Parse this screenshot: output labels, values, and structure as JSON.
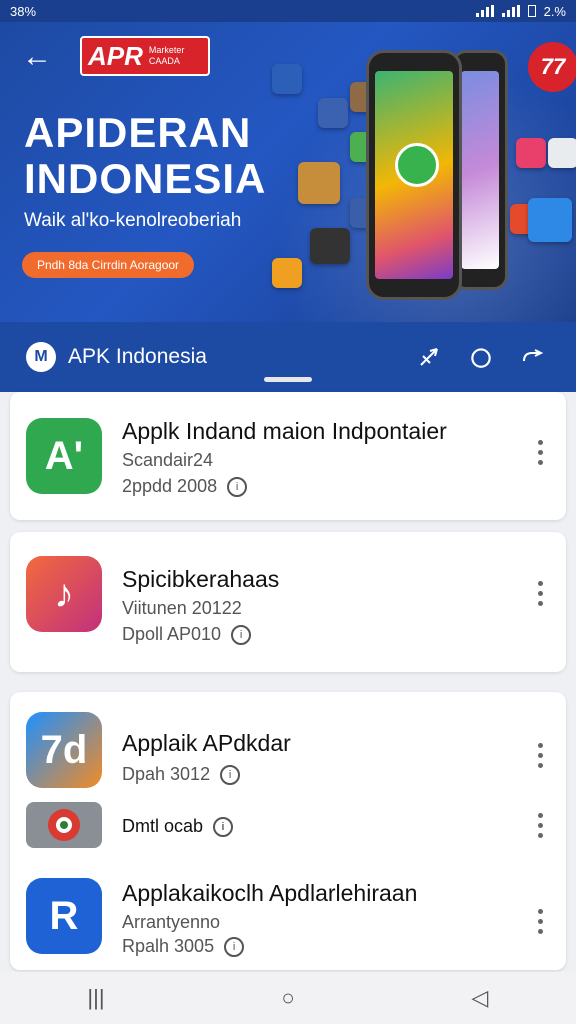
{
  "status_bar": {
    "battery_left": "38%",
    "battery_right": "2.%"
  },
  "hero": {
    "brand_big": "APR",
    "brand_small_1": "Marketer",
    "brand_small_2": "CAADA",
    "headline_1": "APIDERAN",
    "headline_2": "INDONESIA",
    "subtitle": "Waik al'ko-kenolreoberiah",
    "pill": "Pndh 8da Cirrdin Aoragoor",
    "corner_badge": "77"
  },
  "appbar": {
    "logo_letter": "M",
    "title": "APK Indonesia"
  },
  "cards": [
    {
      "rows": [
        {
          "name": "Applk Indand maion Indpontaier",
          "meta1": "Scandair24",
          "meta2": "2ppdd 2008",
          "icon_letter": "A'",
          "icon_color": "#2fa84f"
        }
      ]
    },
    {
      "rows": [
        {
          "name": "Spicibkerahaas",
          "meta1": "Viitunen 20122",
          "meta2": "Dpoll AP010",
          "icon_letter": "♪",
          "icon_color": "#d8405b"
        }
      ]
    },
    {
      "rows": [
        {
          "name": "Applaik APdkdar",
          "meta1": "",
          "meta2": "Dpah 3012",
          "icon_letter": "7d",
          "icon_color": "#2a74d8"
        },
        {
          "name": "",
          "meta1": "",
          "meta2": "Dmtl ocab",
          "icon_letter": "",
          "icon_color": "#8a8f96"
        },
        {
          "name": "Applakaikoclh Apdlarlehiraan",
          "meta1": "Arrantyenno",
          "meta2": "Rpalh 3005",
          "icon_letter": "R",
          "icon_color": "#1e62d6"
        }
      ]
    }
  ],
  "info_glyph": "i",
  "nav": {
    "recent": "|||",
    "home": "○",
    "back": "◁"
  },
  "colors": {
    "primary": "#1d4aa3",
    "accent": "#d8232a",
    "orange": "#f06b2c"
  }
}
